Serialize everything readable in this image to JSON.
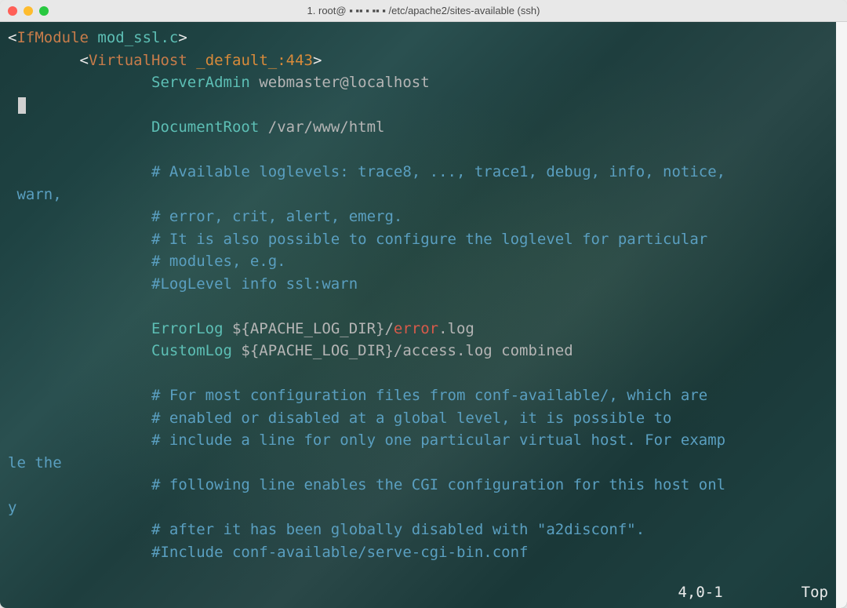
{
  "window": {
    "title": "1. root@  ▪ ▪▪ ▪  ▪▪ ▪  /etc/apache2/sites-available (ssh)"
  },
  "code": {
    "l1_tag_open": "<",
    "l1_tag": "IfModule",
    "l1_sp": " ",
    "l1_arg": "mod_ssl.c",
    "l1_tag_close": ">",
    "l2_indent": "        ",
    "l2_tag_open": "<",
    "l2_tag": "VirtualHost",
    "l2_sp": " ",
    "l2_arg": "_default_:443",
    "l2_tag_close": ">",
    "l3_indent": "                ",
    "l3_key": "ServerAdmin",
    "l3_val": " webmaster@localhost",
    "l4_cursor_indent": " ",
    "l5_indent": "                ",
    "l5_key": "DocumentRoot",
    "l5_val": " /var/www/html",
    "l7_indent": "                ",
    "l7_text": "# Available loglevels: trace8, ..., trace1, debug, info, notice,",
    "l7_wrap": " warn,",
    "l8_indent": "                ",
    "l8_text": "# error, crit, alert, emerg.",
    "l9_indent": "                ",
    "l9_text": "# It is also possible to configure the loglevel for particular",
    "l10_indent": "                ",
    "l10_text": "# modules, e.g.",
    "l11_indent": "                ",
    "l11_text": "#LogLevel info ssl:warn",
    "l13_indent": "                ",
    "l13_key": "ErrorLog",
    "l13_val1": " ${APACHE_LOG_DIR}/",
    "l13_err": "error",
    "l13_val2": ".log",
    "l14_indent": "                ",
    "l14_key": "CustomLog",
    "l14_val": " ${APACHE_LOG_DIR}/access.log combined",
    "l16_indent": "                ",
    "l16_text": "# For most configuration files from conf-available/, which are",
    "l17_indent": "                ",
    "l17_text": "# enabled or disabled at a global level, it is possible to",
    "l18_indent": "                ",
    "l18_text": "# include a line for only one particular virtual host. For examp",
    "l18_wrap": "le the",
    "l19_indent": "                ",
    "l19_text": "# following line enables the CGI configuration for this host onl",
    "l19_wrap": "y",
    "l20_indent": "                ",
    "l20_text": "# after it has been globally disabled with \"a2disconf\".",
    "l21_indent": "                ",
    "l21_text": "#Include conf-available/serve-cgi-bin.conf"
  },
  "status": {
    "position": "4,0-1",
    "scroll": "Top"
  }
}
